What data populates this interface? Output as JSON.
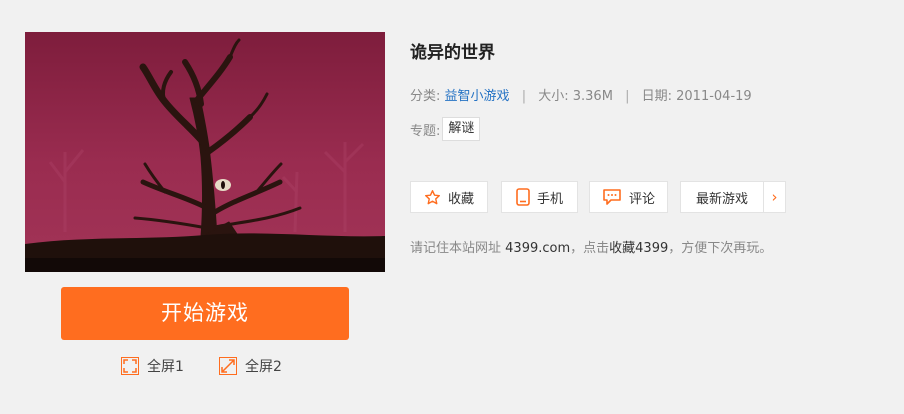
{
  "game": {
    "title": "诡异的世界",
    "category_label": "分类:",
    "category": "益智小游戏",
    "size_label": "大小:",
    "size": "3.36M",
    "date_label": "日期:",
    "date": "2011-04-19",
    "topic_label": "专题:",
    "topic": "解谜"
  },
  "start_button": "开始游戏",
  "fullscreen": {
    "fs1": "全屏1",
    "fs2": "全屏2"
  },
  "actions": {
    "favorite": "收藏",
    "mobile": "手机",
    "comment": "评论",
    "latest": "最新游戏",
    "more": "›"
  },
  "notice": {
    "part1": "请记住本站网址",
    "site": "4399.com",
    "part2": "，点击",
    "fav_link": "收藏4399",
    "part3": "，方便下次再玩。"
  },
  "colors": {
    "accent": "#ff6d1f",
    "link": "#2673c4",
    "thumb_bg": "#8e2446"
  },
  "icons": [
    "star-icon",
    "phone-icon",
    "comment-icon",
    "fullscreen-1-icon",
    "fullscreen-2-icon"
  ]
}
